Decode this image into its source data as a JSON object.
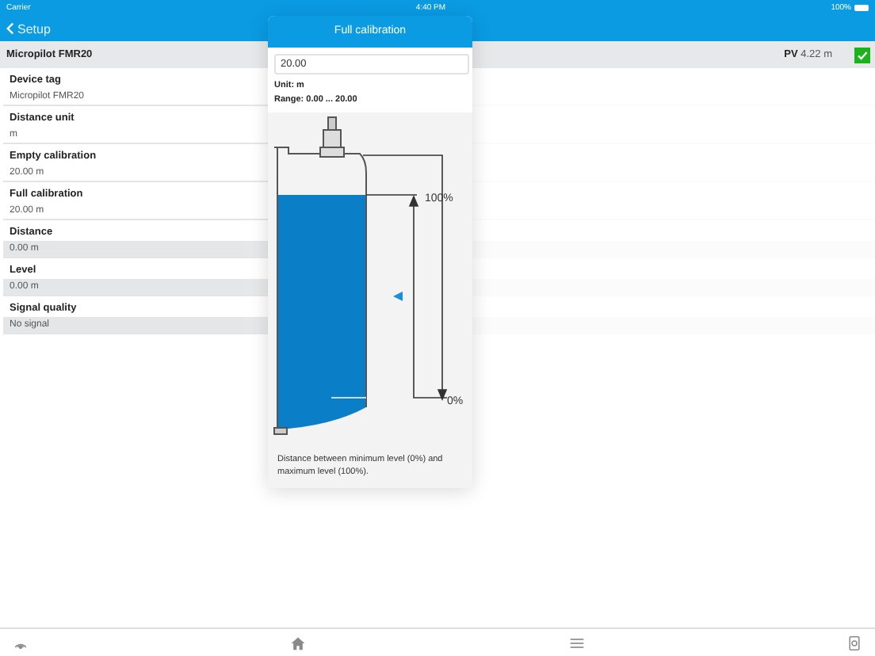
{
  "status_bar": {
    "carrier": "Carrier",
    "time": "4:40 PM",
    "battery": "100%"
  },
  "nav": {
    "back": "Setup"
  },
  "device_header": {
    "name": "Micropilot FMR20",
    "pv_label": "PV",
    "pv_value": "4.22 m",
    "ok": true
  },
  "parameters": [
    {
      "label": "Device tag",
      "value": "Micropilot FMR20",
      "readonly": false
    },
    {
      "label": "Distance unit",
      "value": "m",
      "readonly": false
    },
    {
      "label": "Empty calibration",
      "value": "20.00 m",
      "readonly": false
    },
    {
      "label": "Full calibration",
      "value": "20.00 m",
      "readonly": false
    },
    {
      "label": "Distance",
      "value": "0.00 m",
      "readonly": true
    },
    {
      "label": "Level",
      "value": "0.00 m",
      "readonly": true
    },
    {
      "label": "Signal quality",
      "value": "No signal",
      "readonly": true
    }
  ],
  "popover": {
    "title": "Full calibration",
    "value": "20.00",
    "unit": "Unit: m",
    "range": "Range: 0.00 ... 20.00",
    "top_label": "100%",
    "bottom_label": "0%",
    "description": "Distance between minimum level (0%) and maximum level (100%)."
  },
  "tab_bar": [
    {
      "kind": "signal"
    },
    {
      "kind": "home"
    },
    {
      "kind": "menu"
    },
    {
      "kind": "device"
    }
  ]
}
